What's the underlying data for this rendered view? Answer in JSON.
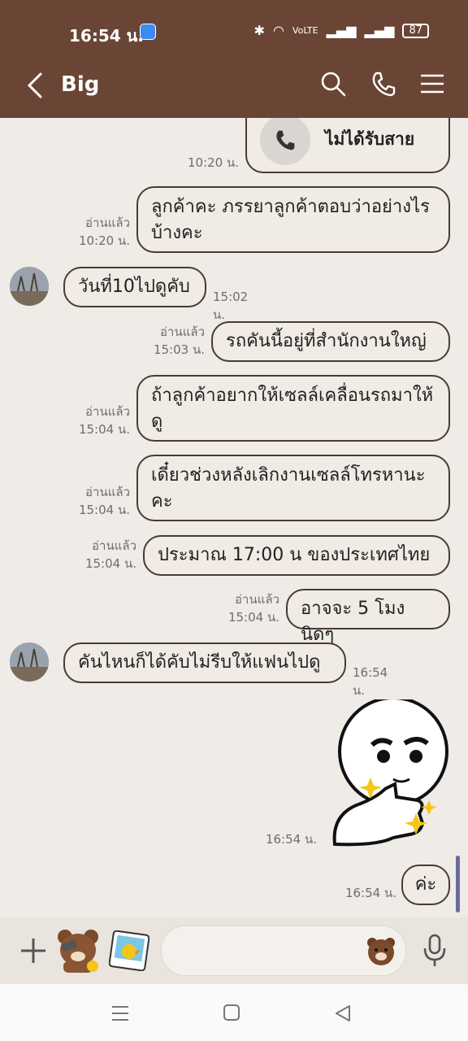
{
  "status_bar": {
    "time": "16:54 น.",
    "battery": "87",
    "network_label": "VoLTE"
  },
  "header": {
    "title": "Big"
  },
  "call_message": {
    "label": "ไม่ได้รับสาย",
    "time": "10:20 น."
  },
  "messages": [
    {
      "text": "ลูกค้าคะ ภรรยาลูกค้าตอบว่าอย่างไรบ้างคะ",
      "read": "อ่านแล้ว",
      "time": "10:20 น."
    },
    {
      "text": "วันที่10ไปดูคับ",
      "time": "15:02 น."
    },
    {
      "text": "รถคันนี้อยู่ที่สำนักงานใหญ่",
      "read": "อ่านแล้ว",
      "time": "15:03 น."
    },
    {
      "text": "ถ้าลูกค้าอยากให้เซลล์เคลื่อนรถมาให้ดู",
      "read": "อ่านแล้ว",
      "time": "15:04 น."
    },
    {
      "text": "เดี๋ยวช่วงหลังเลิกงานเซลล์โทรหานะคะ",
      "read": "อ่านแล้ว",
      "time": "15:04 น."
    },
    {
      "text": "ประมาณ 17:00 น ของประเทศไทย",
      "read": "อ่านแล้ว",
      "time": "15:04 น."
    },
    {
      "text": "อาจจะ 5 โมงนิดๆ",
      "read": "อ่านแล้ว",
      "time": "15:04 น."
    },
    {
      "text": "คันไหนก็ได้คับไม่รีบให้แฟนไปดู",
      "time": "16:54 น."
    },
    {
      "text": "",
      "time": "16:54 น."
    },
    {
      "text": "ค่ะ",
      "time": "16:54 น."
    }
  ]
}
